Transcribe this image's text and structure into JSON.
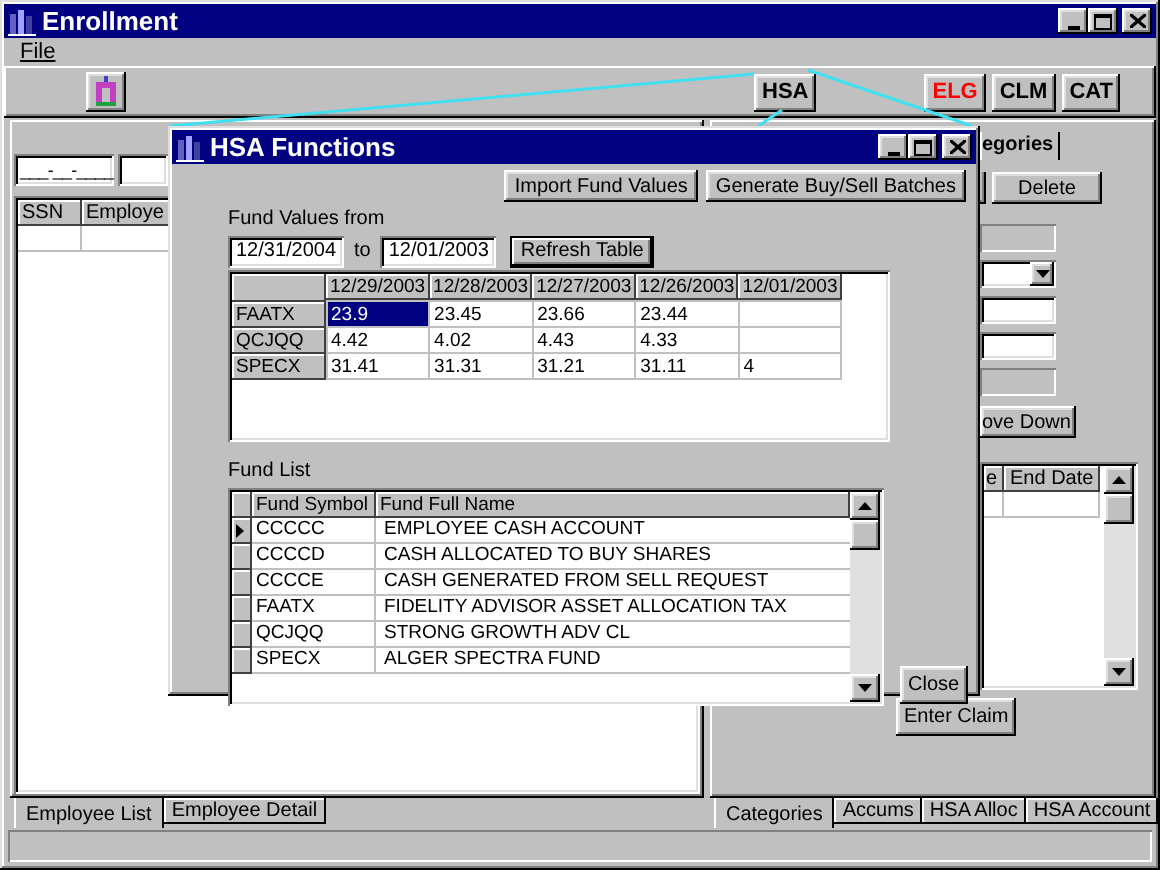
{
  "window": {
    "title": "Enrollment"
  },
  "menu": [
    {
      "label": "File"
    }
  ],
  "toolbar": {
    "center_buttons": [
      {
        "label": "HSA",
        "color": "#000000"
      }
    ],
    "right_buttons": [
      {
        "label": "ELG",
        "color": "#ff0000"
      },
      {
        "label": "CLM",
        "color": "#000000"
      },
      {
        "label": "CAT",
        "color": "#000000"
      }
    ]
  },
  "employee_panel": {
    "ssn_field": {
      "value": "___-__-____"
    },
    "grid": {
      "columns": [
        "SSN",
        "Employe"
      ]
    },
    "tabs": [
      {
        "label": "Employee List",
        "selected": true
      },
      {
        "label": "Employee Detail",
        "selected": false
      }
    ]
  },
  "claims_panel": {
    "inner_tab": {
      "label": "egories"
    },
    "buttons": [
      "Delete"
    ],
    "fields": [
      {
        "kind": "text",
        "disabled": true
      },
      {
        "kind": "combo",
        "disabled": false
      },
      {
        "kind": "text",
        "disabled": false
      },
      {
        "kind": "text",
        "disabled": false
      },
      {
        "kind": "text",
        "disabled": true
      }
    ],
    "move_button": "ove Down",
    "grid": {
      "columns": [
        "e",
        "End Date"
      ]
    },
    "enter_claim_button": "Enter Claim",
    "tabs": [
      {
        "label": "Categories",
        "selected": true
      },
      {
        "label": "Accums",
        "selected": false
      },
      {
        "label": "HSA Alloc",
        "selected": false
      },
      {
        "label": "HSA Account",
        "selected": false
      }
    ]
  },
  "dialog": {
    "title": "HSA Functions",
    "buttons": [
      "Import Fund Values",
      "Generate Buy/Sell Batches"
    ],
    "range_label": "Fund Values from",
    "from_date": "12/31/2004",
    "to_label": "to",
    "to_date": "12/01/2003",
    "refresh_button": "Refresh Table",
    "fund_values": {
      "columns": [
        "12/29/2003",
        "12/28/2003",
        "12/27/2003",
        "12/26/2003",
        "12/01/2003"
      ],
      "rows": [
        {
          "symbol": "FAATX",
          "cells": [
            {
              "text": "23.9",
              "selected": true
            },
            {
              "text": "23.45",
              "selected": false
            },
            {
              "text": "23.66",
              "selected": false
            },
            {
              "text": "23.44",
              "selected": false
            }
          ]
        },
        {
          "symbol": "QCJQQ",
          "cells": [
            {
              "text": "4.42",
              "selected": false
            },
            {
              "text": "4.02",
              "selected": false
            },
            {
              "text": "4.43",
              "selected": false
            },
            {
              "text": "4.33",
              "selected": false
            }
          ]
        },
        {
          "symbol": "SPECX",
          "cells": [
            {
              "text": "31.41",
              "selected": false
            },
            {
              "text": "31.31",
              "selected": false
            },
            {
              "text": "31.21",
              "selected": false
            },
            {
              "text": "31.11",
              "selected": false
            },
            {
              "text": "4",
              "selected": false
            }
          ]
        }
      ]
    },
    "fund_list_label": "Fund List",
    "fund_list": {
      "columns": [
        "Fund Symbol",
        "Fund Full Name"
      ],
      "rows": [
        {
          "symbol": "CCCCC",
          "name": "EMPLOYEE CASH ACCOUNT",
          "selected": true
        },
        {
          "symbol": "CCCCD",
          "name": "CASH ALLOCATED TO BUY SHARES",
          "selected": false
        },
        {
          "symbol": "CCCCE",
          "name": "CASH GENERATED FROM SELL REQUEST",
          "selected": false
        },
        {
          "symbol": "FAATX",
          "name": "FIDELITY ADVISOR ASSET ALLOCATION TAX",
          "selected": false
        },
        {
          "symbol": "QCJQQ",
          "name": "STRONG GROWTH ADV CL",
          "selected": false
        },
        {
          "symbol": "SPECX",
          "name": "ALGER SPECTRA FUND",
          "selected": false
        }
      ]
    },
    "close_button": "Close"
  }
}
